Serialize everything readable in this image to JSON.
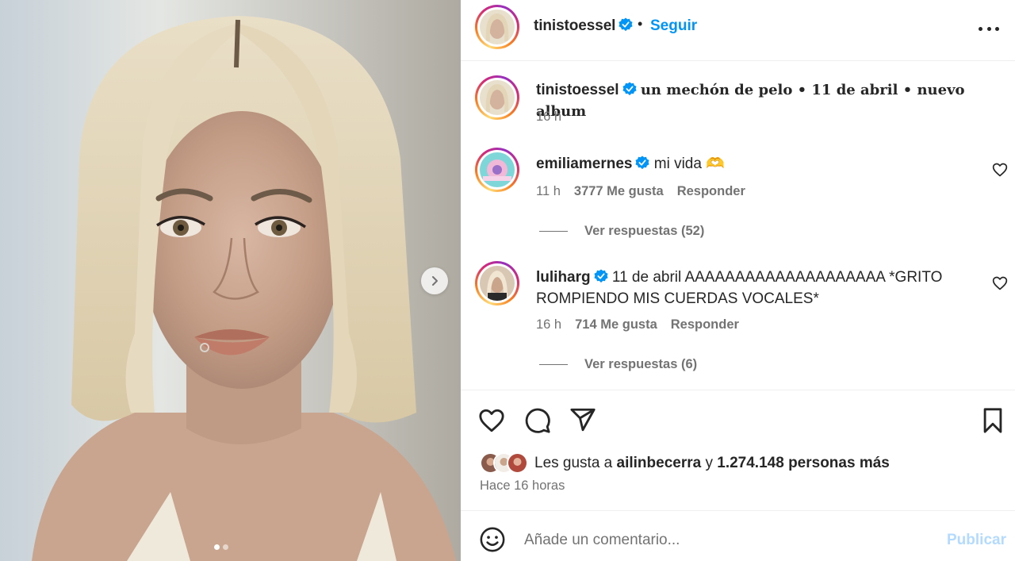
{
  "header": {
    "username": "tinistoessel",
    "separator": "•",
    "follow_label": "Seguir"
  },
  "caption": {
    "username": "tinistoessel",
    "text": "un mechón de pelo • 11 de abril • nuevo album",
    "time": "16 h"
  },
  "comments": [
    {
      "username": "emiliamernes",
      "text": "mi vida 🫶",
      "time": "11 h",
      "likes": "3777 Me gusta",
      "reply_label": "Responder",
      "view_replies": "Ver respuestas (52)"
    },
    {
      "username": "luliharg",
      "text": "11 de abril AAAAAAAAAAAAAAAAAAAA *GRITO ROMPIENDO MIS CUERDAS VOCALES*",
      "time": "16 h",
      "likes": "714 Me gusta",
      "reply_label": "Responder",
      "view_replies": "Ver respuestas (6)"
    }
  ],
  "likes": {
    "prefix": "Les gusta a",
    "first_user": "ailinbecerra",
    "connector": "y",
    "others": "1.274.148 personas más"
  },
  "posted_ago": "Hace 16 horas",
  "comment_box": {
    "placeholder": "Añade un comentario...",
    "publish_label": "Publicar"
  },
  "carousel": {
    "current_slide": 1,
    "total_slides": 2
  },
  "icons": {
    "verified": "verified-badge-icon",
    "more": "more-options-icon",
    "like": "heart-icon",
    "comment": "comment-icon",
    "share": "send-icon",
    "save": "bookmark-icon",
    "emoji": "emoji-icon",
    "next": "chevron-right-icon"
  },
  "colors": {
    "accent": "#0095f6",
    "publish_disabled": "#b3dbff",
    "verified": "#0095f6",
    "muted_text": "#737373"
  }
}
